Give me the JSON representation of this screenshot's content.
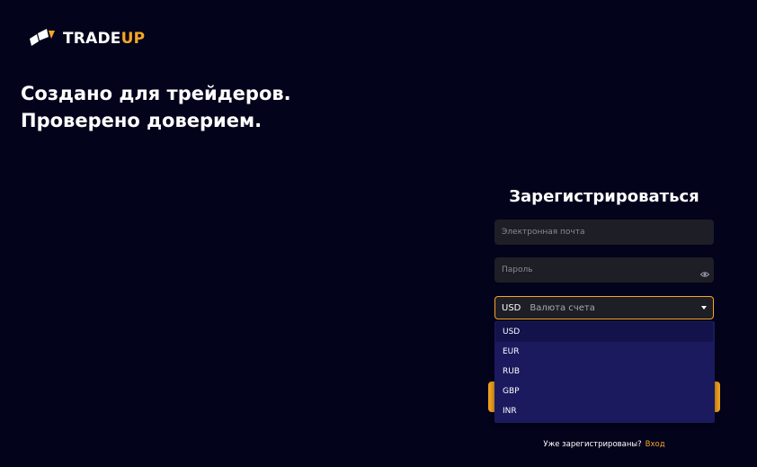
{
  "brand": {
    "name_part1": "TRADE",
    "name_part2": "UP",
    "accent_color": "#f5a623",
    "logo_icon": "tradeup-logo-icon"
  },
  "hero": {
    "headline": "Создано для трейдеров. Проверено доверием."
  },
  "register": {
    "title": "Зарегистрироваться",
    "email_placeholder": "Электронная почта",
    "password_placeholder": "Пароль",
    "password_toggle_icon": "eye-icon",
    "currency": {
      "selected": "USD",
      "placeholder": "Валюта счета",
      "options": [
        "USD",
        "EUR",
        "RUB",
        "GBP",
        "INR"
      ],
      "active_index": 0
    },
    "footer_prompt": "Уже зарегистрированы?",
    "login_link": "Вход"
  }
}
